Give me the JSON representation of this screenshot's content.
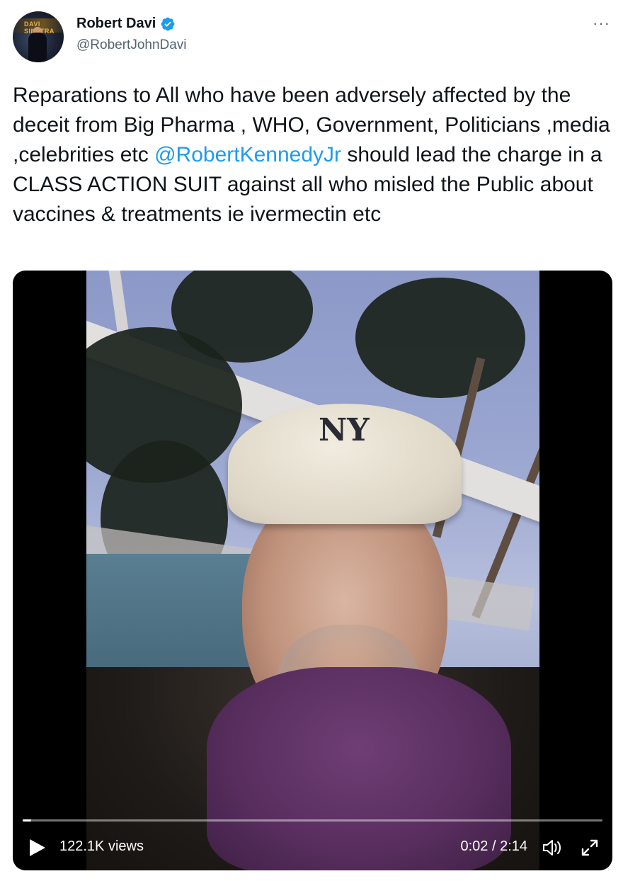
{
  "author": {
    "display_name": "Robert Davi",
    "handle": "@RobertJohnDavi",
    "verified": true,
    "avatar_text": "DAVI SINATRA"
  },
  "more_label": "···",
  "tweet": {
    "text_before": "Reparations to All who have been adversely affected by the deceit from Big Pharma , WHO, Government, Politicians ,media ,celebrities etc ",
    "mention": "@RobertKennedyJr",
    "text_after": " should lead the charge in a CLASS ACTION SUIT against all who misled the Public about vaccines & treatments ie ivermectin etc"
  },
  "video": {
    "views": "122.1K views",
    "time": "0:02 / 2:14",
    "progress": 0.015,
    "cap_logo": "NY"
  },
  "colors": {
    "accent": "#1d9bf0",
    "text": "#0f1419",
    "muted": "#536471"
  }
}
